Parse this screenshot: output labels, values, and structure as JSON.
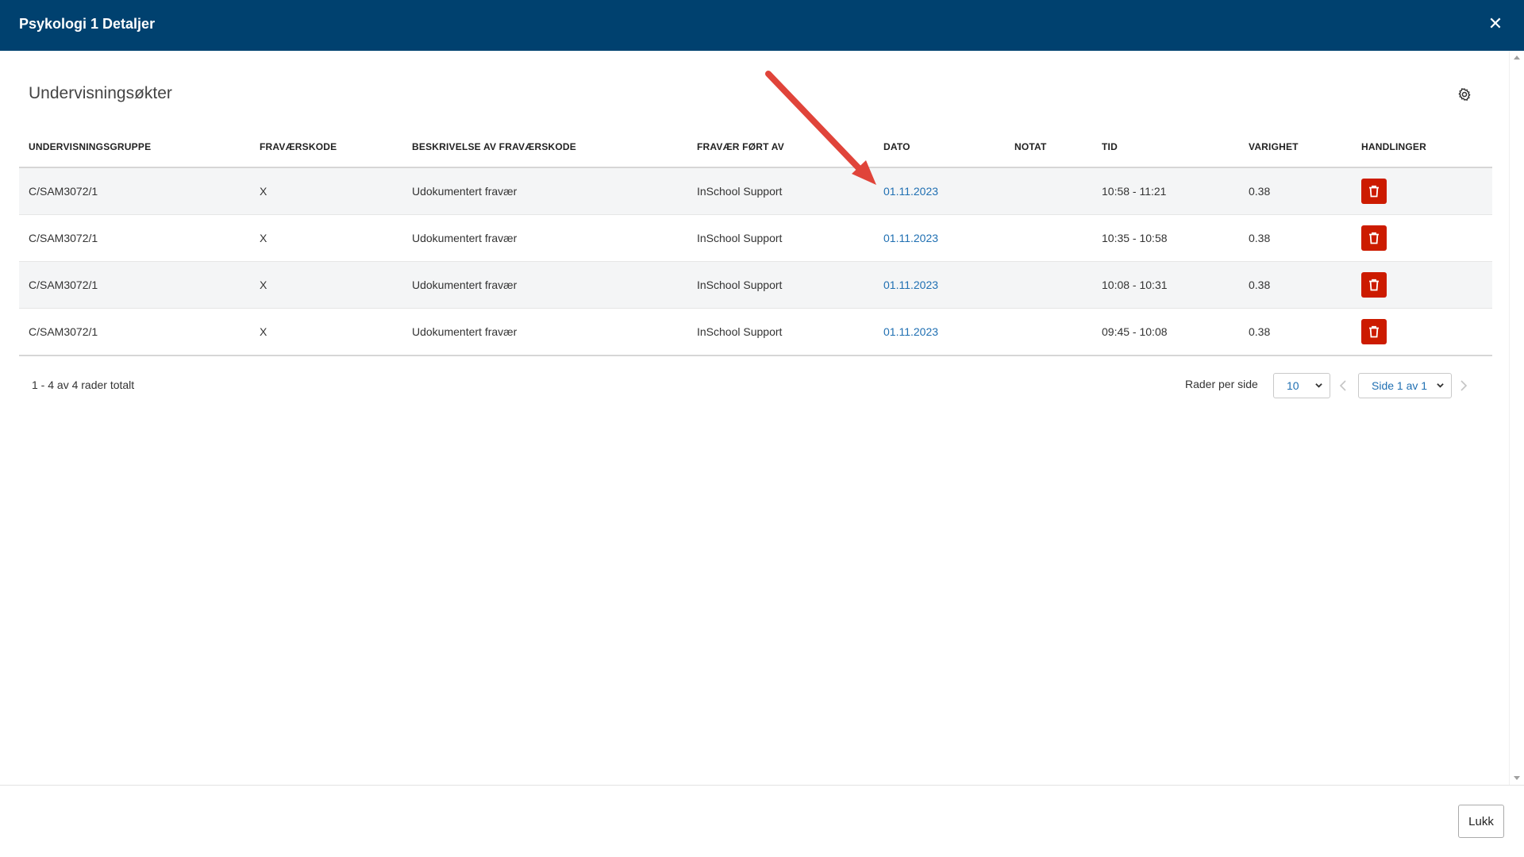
{
  "header": {
    "title": "Psykologi 1 Detaljer",
    "close_glyph": "✕"
  },
  "section": {
    "title": "Undervisningsøkter"
  },
  "table": {
    "columns": [
      "UNDERVISNINGSGRUPPE",
      "FRAVÆRSKODE",
      "BESKRIVELSE AV FRAVÆRSKODE",
      "FRAVÆR FØRT AV",
      "DATO",
      "NOTAT",
      "TID",
      "VARIGHET",
      "HANDLINGER"
    ],
    "rows": [
      {
        "group": "C/SAM3072/1",
        "code": "X",
        "description": "Udokumentert fravær",
        "registered_by": "InSchool Support",
        "date": "01.11.2023",
        "note": "",
        "time": "10:58 - 11:21",
        "duration": "0.38"
      },
      {
        "group": "C/SAM3072/1",
        "code": "X",
        "description": "Udokumentert fravær",
        "registered_by": "InSchool Support",
        "date": "01.11.2023",
        "note": "",
        "time": "10:35 - 10:58",
        "duration": "0.38"
      },
      {
        "group": "C/SAM3072/1",
        "code": "X",
        "description": "Udokumentert fravær",
        "registered_by": "InSchool Support",
        "date": "01.11.2023",
        "note": "",
        "time": "10:08 - 10:31",
        "duration": "0.38"
      },
      {
        "group": "C/SAM3072/1",
        "code": "X",
        "description": "Udokumentert fravær",
        "registered_by": "InSchool Support",
        "date": "01.11.2023",
        "note": "",
        "time": "09:45 - 10:08",
        "duration": "0.38"
      }
    ]
  },
  "pagination": {
    "summary": "1 - 4 av 4 rader totalt",
    "rows_per_page_label": "Rader per side",
    "rows_per_page_value": "10",
    "page_value": "Side 1 av 1"
  },
  "footer": {
    "close_label": "Lukk"
  },
  "colors": {
    "header_bg": "#00416f",
    "delete_button": "#cc1b00",
    "link": "#1f6fb2",
    "annotation_arrow": "#e0443a"
  },
  "icons": {
    "settings": "gear-icon",
    "delete": "trash-icon",
    "close": "close-icon",
    "prev_page": "chevron-left-icon",
    "next_page": "chevron-right-icon",
    "annotation": "red-arrow-icon"
  }
}
